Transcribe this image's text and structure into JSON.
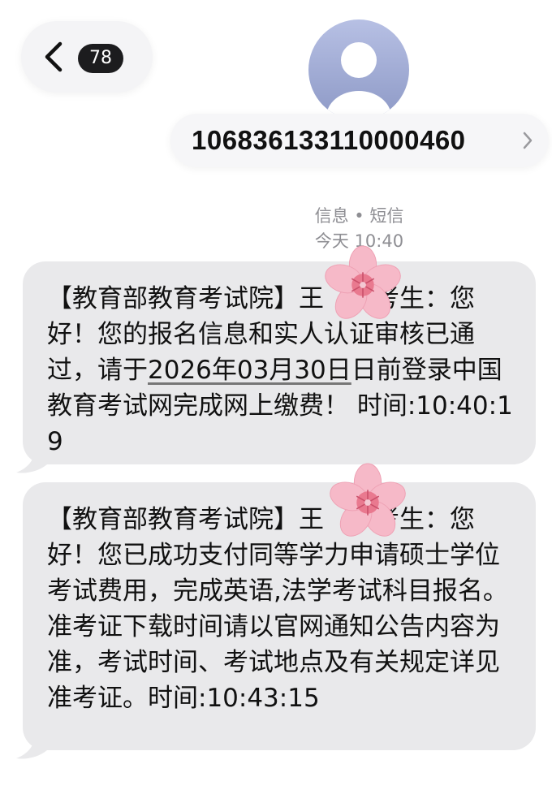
{
  "header": {
    "unread_count": "78",
    "sender_number": "106836133110000460",
    "icons": {
      "back": "chevron-left-icon",
      "avatar": "person-avatar-icon",
      "detail": "chevron-right-icon"
    }
  },
  "meta": {
    "service": "信息 • 短信",
    "timestamp": "今天 10:40"
  },
  "messages": [
    {
      "part1": "【教育部教育考试院】王",
      "part2": "考生：您好！您的报名信息和实人认证审核已通过，请于",
      "date_link": "2026年03月30日",
      "part3": "日前登录中国教育考试网完成网上缴费！ 时间:10:40:19"
    },
    {
      "part1": "【教育部教育考试院】王",
      "part2": "考生：您好！您已成功支付同等学力申请硕士学位考试费用，完成英语,法学考试科目报名。准考证下载时间请以官网通知公告内容为准，考试时间、考试地点及有关规定详见准考证。时间:10:43:15"
    }
  ],
  "colors": {
    "bubble": "#e9e9eb",
    "badge": "#1c1c1e",
    "avatar": "#a3aed6",
    "flower": "#f6b9c8"
  }
}
